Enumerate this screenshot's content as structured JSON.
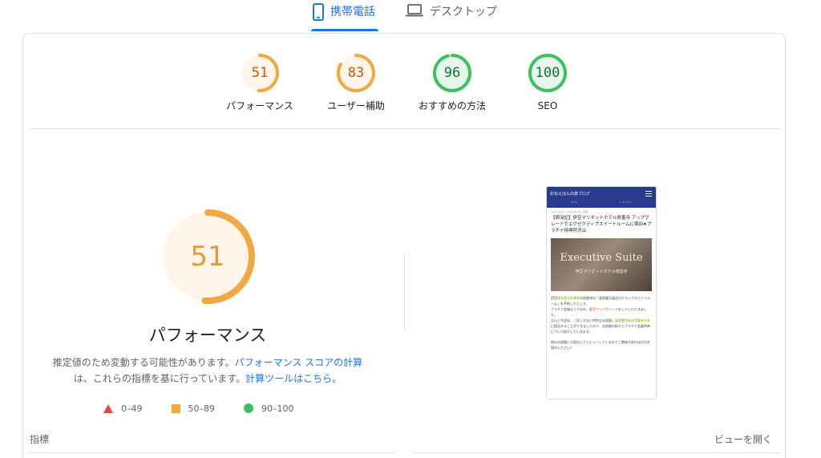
{
  "tabs": {
    "mobile": {
      "label": "携帯電話",
      "icon": "smartphone-icon"
    },
    "desktop": {
      "label": "デスクトップ",
      "icon": "laptop-icon"
    }
  },
  "scores": [
    {
      "value": "51",
      "label": "パフォーマンス",
      "fraction": 0.51,
      "color": "#f0a843",
      "track": "#fef4e7",
      "text_color": "#c25b0f"
    },
    {
      "value": "83",
      "label": "ユーザー補助",
      "fraction": 0.83,
      "color": "#f0a843",
      "track": "#fef4e7",
      "text_color": "#c25b0f"
    },
    {
      "value": "96",
      "label": "おすすめの方法",
      "fraction": 0.96,
      "color": "#3dbf62",
      "track": "#e6f6ec",
      "text_color": "#137333"
    },
    {
      "value": "100",
      "label": "SEO",
      "fraction": 1.0,
      "color": "#3dbf62",
      "track": "#e6f6ec",
      "text_color": "#137333"
    }
  ],
  "main_gauge": {
    "value": "51",
    "fraction": 0.51,
    "title": "パフォーマンス",
    "color": "#f0a843",
    "track": "#fef4e7",
    "text_color": "#e29c3e"
  },
  "description": {
    "text1": "推定値のため変動する可能性があります。",
    "link1": "パフォーマンス スコアの計算",
    "text2": "は、これらの指標を基に行っています。",
    "link2": "計算ツールはこちら。"
  },
  "legend": {
    "fail": "0–49",
    "average": "50–89",
    "pass": "90–100"
  },
  "metrics_label": "指標",
  "open_view_label": "ビューを開く",
  "preview": {
    "site_name": "おねえほんの旅ブログ",
    "nav": [
      "ホテル",
      "レストラン"
    ],
    "meta": "2022.03.10 · 2022.05.09 · 静岡",
    "title": "【宿泊記】伊豆マリオットホテル修善寺 アップグレードでエグゼクティブスイートルームに宿泊★プラチナ特典狩沢山",
    "hero_title": "Executive Suite",
    "hero_sub": "伊豆マリオットホテル修善寺",
    "p1a": "伊豆マリオットホテル修善寺",
    "p1b": "の「温泉露天風呂付デラックスツインルーム」を予約したところ、",
    "p2a": "プラチナ会員ならではの、",
    "p2b": "客室アップグレード",
    "p2c": "をしていただきました。",
    "p3a": "なんと今回は、「珍しかない特別なお部屋」",
    "p3b": "エグゼクティブスイート",
    "p3c": "に宿泊することができましたので、お部屋の紹介とプラチナ会員特典について紹介していきます。",
    "p4": "他のお部屋にも宿泊してレビューしているのでご興味があればぜひお読みください♪"
  }
}
